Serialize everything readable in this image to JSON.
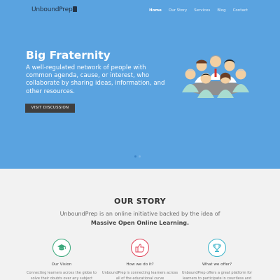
{
  "nav": {
    "logo_text": "UnboundPrep",
    "items": [
      {
        "label": "Home",
        "active": true
      },
      {
        "label": "Our Story",
        "active": false
      },
      {
        "label": "Services",
        "active": false
      },
      {
        "label": "Blog",
        "active": false
      },
      {
        "label": "Contact",
        "active": false
      }
    ]
  },
  "hero": {
    "title": "Big Fraternity",
    "description": "A well-regulated network of people with common agenda, cause, or interest, who collaborate by sharing ideas, information, and other resources.",
    "button_label": "VISIT DISCUSSION",
    "slider": {
      "count": 2,
      "active_index": 0
    },
    "illustration_icon": "team-meeting-illustration"
  },
  "story": {
    "title": "OUR STORY",
    "text_part1": "UnboundPrep is an online initiative backed by the idea of",
    "text_part2": "Massive Open Online Learning.",
    "features": [
      {
        "icon": "graduation-cap-icon",
        "color": "#3aa87b",
        "title": "Our Vision",
        "desc": "Connecting learners across the globe to solve their doubts over any subject"
      },
      {
        "icon": "thumbs-up-icon",
        "color": "#e0455a",
        "title": "How we do it?",
        "desc": "UnboundPrep is connecting learners across all of the educational curve"
      },
      {
        "icon": "trophy-icon",
        "color": "#3bb3c9",
        "title": "What we offer?",
        "desc": "UnboundPrep offers a great platform for learners to participate in countless and"
      }
    ]
  },
  "colors": {
    "hero_bg": "#5aa3e0",
    "button_bg": "#3f3f3f",
    "page_bg": "#f2f2f2"
  }
}
